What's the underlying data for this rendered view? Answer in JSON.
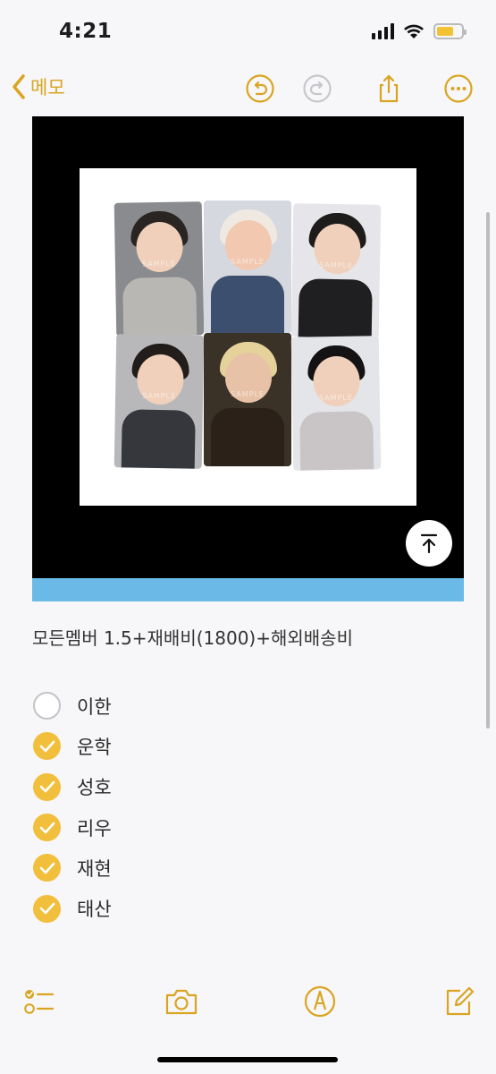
{
  "status": {
    "time": "4:21"
  },
  "nav": {
    "back_label": "메모",
    "accent": "#d9a521"
  },
  "note": {
    "line": "모든멤버 1.5+재배비(1800)+해외배송비",
    "checklist": [
      {
        "label": "이한",
        "checked": false
      },
      {
        "label": "운학",
        "checked": true
      },
      {
        "label": "성호",
        "checked": true
      },
      {
        "label": "리우",
        "checked": true
      },
      {
        "label": "재현",
        "checked": true
      },
      {
        "label": "태산",
        "checked": true
      }
    ]
  },
  "photo": {
    "watermark": "SAMPLE",
    "card_count": 6
  },
  "colors": {
    "accent": "#d9a521",
    "check_fill": "#f2bf3c",
    "strip": "#6ab9e6"
  },
  "toolbar": {
    "icons": [
      "checklist-icon",
      "camera-icon",
      "markup-pen-icon",
      "compose-icon"
    ]
  }
}
